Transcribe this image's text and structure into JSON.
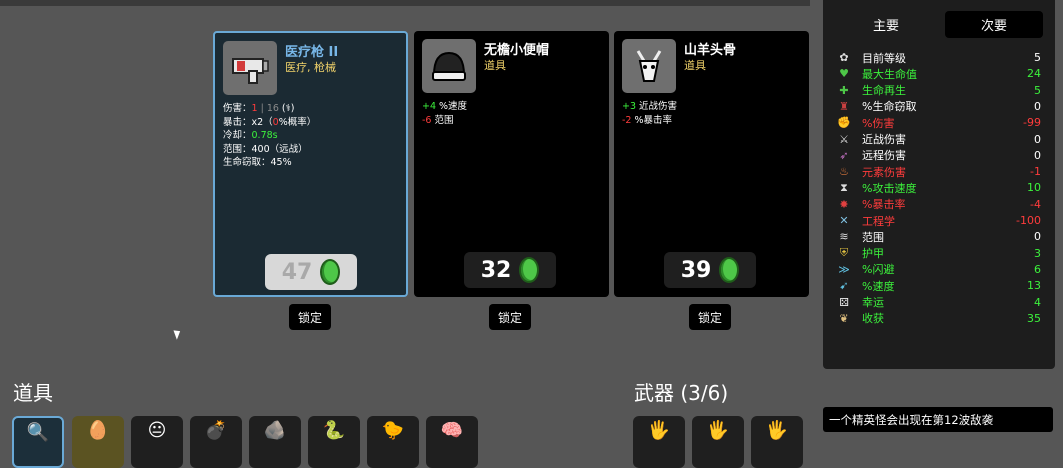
{
  "shop": {
    "items": [
      {
        "name": "医疗枪 II",
        "type": "医疗, 枪械",
        "price": "47",
        "lock_label": "锁定",
        "stats": [
          {
            "parts": [
              {
                "t": "伤害：",
                "c": ""
              },
              {
                "t": "1",
                "c": "red"
              },
              {
                "t": " | ",
                "c": "gry"
              },
              {
                "t": "16",
                "c": "gry"
              },
              {
                "t": " (",
                "c": ""
              },
              {
                "t": "⚕",
                "c": ""
              },
              {
                "t": ")",
                "c": ""
              }
            ]
          },
          {
            "parts": [
              {
                "t": "暴击：x2（",
                "c": ""
              },
              {
                "t": "0",
                "c": "red"
              },
              {
                "t": "%概率）",
                "c": ""
              }
            ]
          },
          {
            "parts": [
              {
                "t": "冷却：",
                "c": ""
              },
              {
                "t": "0.78s",
                "c": "grn"
              }
            ]
          },
          {
            "parts": [
              {
                "t": "范围：400（远战）",
                "c": ""
              }
            ]
          },
          {
            "parts": [
              {
                "t": "生命窃取：45%",
                "c": ""
              }
            ]
          }
        ]
      },
      {
        "name": "无檐小便帽",
        "type": "道具",
        "price": "32",
        "lock_label": "锁定",
        "stats": [
          {
            "parts": [
              {
                "t": "+4",
                "c": "grn"
              },
              {
                "t": " %速度",
                "c": ""
              }
            ]
          },
          {
            "parts": [
              {
                "t": "-6",
                "c": "red"
              },
              {
                "t": " 范围",
                "c": ""
              }
            ]
          }
        ]
      },
      {
        "name": "山羊头骨",
        "type": "道具",
        "price": "39",
        "lock_label": "锁定",
        "stats": [
          {
            "parts": [
              {
                "t": "+3",
                "c": "grn"
              },
              {
                "t": " 近战伤害",
                "c": ""
              }
            ]
          },
          {
            "parts": [
              {
                "t": "-2",
                "c": "red"
              },
              {
                "t": " %暴击率",
                "c": ""
              }
            ]
          }
        ]
      }
    ]
  },
  "stats_panel": {
    "tabs": [
      "主要",
      "次要"
    ],
    "rows": [
      {
        "label": "目前等级",
        "value": "5",
        "color": "#ffffff",
        "icon": "level-icon"
      },
      {
        "label": "最大生命值",
        "value": "24",
        "color": "#3cf23c",
        "icon": "heart-icon"
      },
      {
        "label": "生命再生",
        "value": "5",
        "color": "#3cf23c",
        "icon": "regen-icon"
      },
      {
        "label": "%生命窃取",
        "value": "0",
        "color": "#ffffff",
        "icon": "lifesteal-icon"
      },
      {
        "label": "%伤害",
        "value": "-99",
        "color": "#ff3c3c",
        "icon": "damage-icon"
      },
      {
        "label": "近战伤害",
        "value": "0",
        "color": "#ffffff",
        "icon": "melee-icon"
      },
      {
        "label": "远程伤害",
        "value": "0",
        "color": "#ffffff",
        "icon": "ranged-icon"
      },
      {
        "label": "元素伤害",
        "value": "-1",
        "color": "#ff3c3c",
        "icon": "elemental-icon"
      },
      {
        "label": "%攻击速度",
        "value": "10",
        "color": "#3cf23c",
        "icon": "attack-speed-icon"
      },
      {
        "label": "%暴击率",
        "value": "-4",
        "color": "#ff3c3c",
        "icon": "crit-icon"
      },
      {
        "label": "工程学",
        "value": "-100",
        "color": "#ff3c3c",
        "icon": "engineering-icon"
      },
      {
        "label": "范围",
        "value": "0",
        "color": "#ffffff",
        "icon": "range-icon"
      },
      {
        "label": "护甲",
        "value": "3",
        "color": "#3cf23c",
        "icon": "armor-icon"
      },
      {
        "label": "%闪避",
        "value": "6",
        "color": "#3cf23c",
        "icon": "dodge-icon"
      },
      {
        "label": "%速度",
        "value": "13",
        "color": "#3cf23c",
        "icon": "speed-icon"
      },
      {
        "label": "幸运",
        "value": "4",
        "color": "#3cf23c",
        "icon": "luck-icon"
      },
      {
        "label": "收获",
        "value": "35",
        "color": "#3cf23c",
        "icon": "harvest-icon"
      }
    ]
  },
  "inventory": {
    "items_title": "道具",
    "weapons_title": "武器 (3/6)"
  },
  "notice": "一个精英怪会出现在第12波敌袭",
  "colors": {
    "accent_blue": "#6aa9d6",
    "positive": "#3cf23c",
    "negative": "#ff3c3c",
    "item_type": "#f1d26a"
  }
}
